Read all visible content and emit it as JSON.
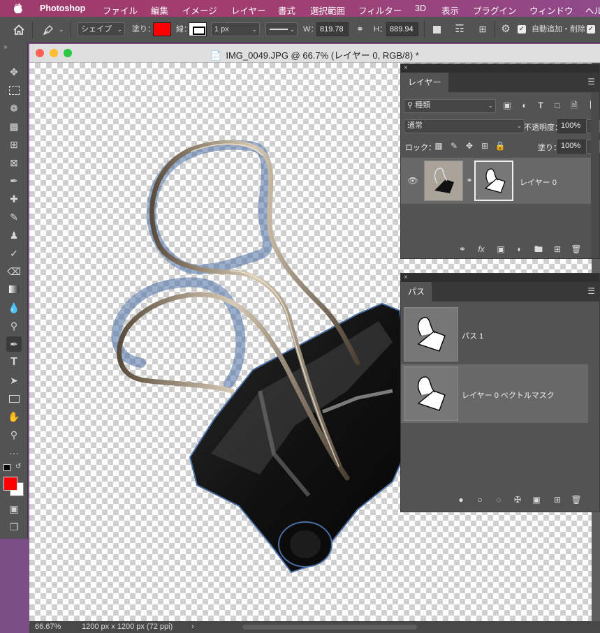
{
  "menubar": {
    "apple": "",
    "app": "Photoshop",
    "items": [
      "ファイル",
      "編集",
      "イメージ",
      "レイヤー",
      "書式",
      "選択範囲",
      "フィルター",
      "3D",
      "表示",
      "プラグイン",
      "ウィンドウ",
      "ヘルプ"
    ]
  },
  "options": {
    "mode": "シェイプ",
    "fill_label": "塗り：",
    "fill_color": "#ff0000",
    "stroke_label": "線：",
    "stroke_width": "1 px",
    "w_label": "W：",
    "w_value": "819.78",
    "h_label": "H：",
    "h_value": "889.94",
    "auto_add_label": "自動追加・削除"
  },
  "document": {
    "title": "IMG_0049.JPG @ 66.7% (レイヤー 0, RGB/8) *",
    "zoom": "66.67%",
    "size_info": "1200 px x 1200 px (72 ppi)",
    "status_arrow": "›"
  },
  "tools": {
    "grip": "»",
    "foreground": "#ff0000",
    "background": "#ffffff"
  },
  "layers_panel": {
    "close": "×",
    "tab": "レイヤー",
    "filter_label": "種類",
    "blend_mode": "通常",
    "opacity_label": "不透明度：",
    "opacity_value": "100%",
    "lock_label": "ロック：",
    "fill_label": "塗り：",
    "fill_value": "100%",
    "layer_name": "レイヤー 0",
    "fx": "fx"
  },
  "paths_panel": {
    "close": "×",
    "tab": "パス",
    "paths": [
      "パス 1",
      "レイヤー 0 ベクトルマスク"
    ]
  }
}
